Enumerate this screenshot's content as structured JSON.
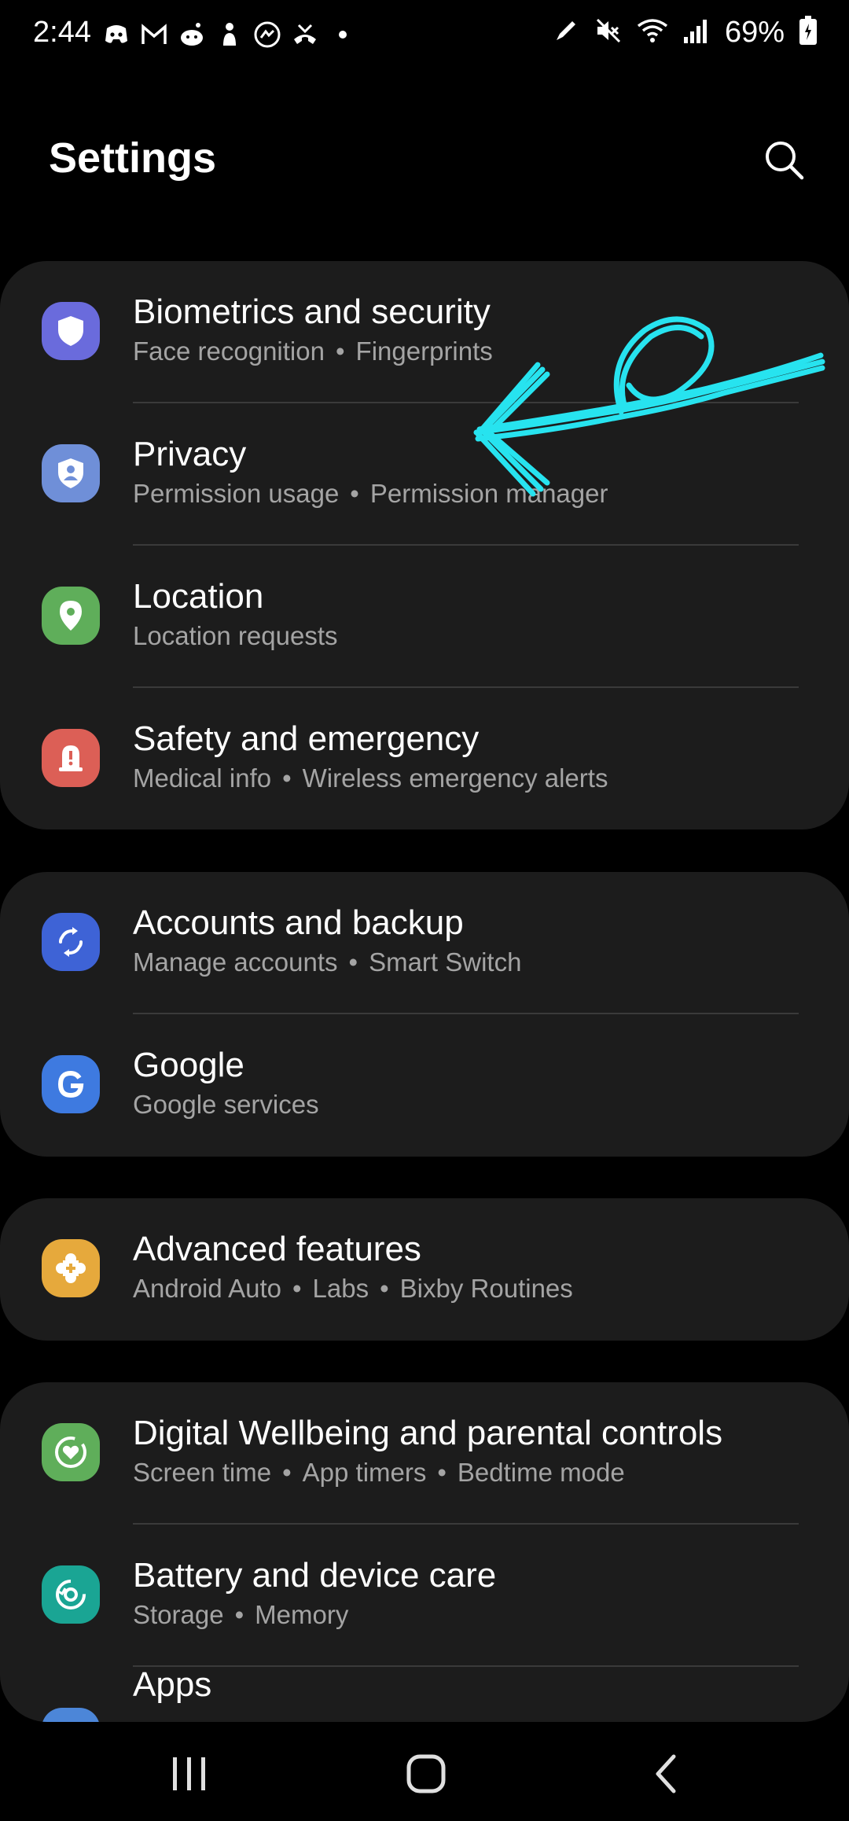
{
  "status_bar": {
    "time": "2:44",
    "battery_percent": "69%"
  },
  "header": {
    "title": "Settings"
  },
  "groups": [
    {
      "items": [
        {
          "title": "Biometrics and security",
          "subs": [
            "Face recognition",
            "Fingerprints"
          ],
          "icon": "shield-icon",
          "color": "#6a6bdc"
        },
        {
          "title": "Privacy",
          "subs": [
            "Permission usage",
            "Permission manager"
          ],
          "icon": "privacy-shield-icon",
          "color": "#6f8fd8"
        },
        {
          "title": "Location",
          "subs": [
            "Location requests"
          ],
          "icon": "location-pin-icon",
          "color": "#5fae5a"
        },
        {
          "title": "Safety and emergency",
          "subs": [
            "Medical info",
            "Wireless emergency alerts"
          ],
          "icon": "emergency-alert-icon",
          "color": "#dc5f56"
        }
      ]
    },
    {
      "items": [
        {
          "title": "Accounts and backup",
          "subs": [
            "Manage accounts",
            "Smart Switch"
          ],
          "icon": "sync-icon",
          "color": "#3e63d6"
        },
        {
          "title": "Google",
          "subs": [
            "Google services"
          ],
          "icon": "google-icon",
          "color": "#3e7ae0"
        }
      ]
    },
    {
      "items": [
        {
          "title": "Advanced features",
          "subs": [
            "Android Auto",
            "Labs",
            "Bixby Routines"
          ],
          "icon": "puzzle-plus-icon",
          "color": "#e6a93c"
        }
      ]
    },
    {
      "items": [
        {
          "title": "Digital Wellbeing and parental controls",
          "subs": [
            "Screen time",
            "App timers",
            "Bedtime mode"
          ],
          "icon": "wellbeing-heart-icon",
          "color": "#5fae5a"
        },
        {
          "title": "Battery and device care",
          "subs": [
            "Storage",
            "Memory"
          ],
          "icon": "device-care-icon",
          "color": "#1aa594"
        },
        {
          "title": "Apps",
          "subs": [],
          "icon": "apps-icon",
          "color": "#4c86d8"
        }
      ]
    }
  ],
  "annotation": {
    "color": "#27e3ef"
  }
}
